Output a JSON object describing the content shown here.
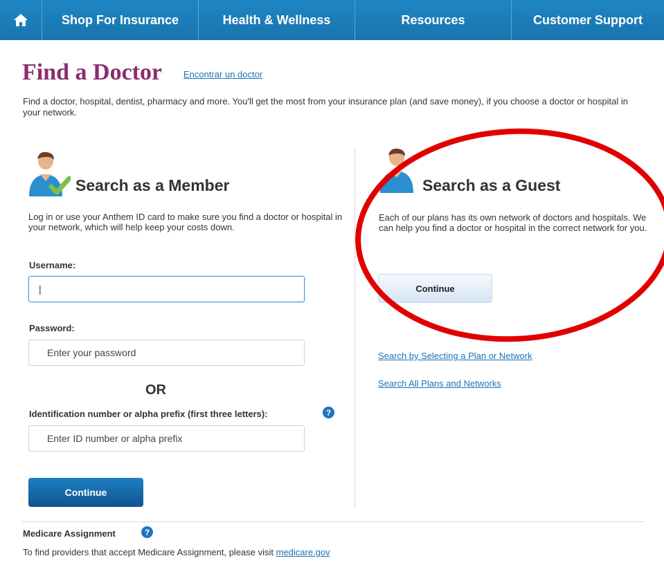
{
  "nav": {
    "home_icon": "home-icon",
    "items": [
      {
        "label": "Shop For Insurance"
      },
      {
        "label": "Health & Wellness"
      },
      {
        "label": "Resources"
      },
      {
        "label": "Customer Support"
      }
    ]
  },
  "header": {
    "title": "Find a Doctor",
    "alt_link": "Encontrar un doctor",
    "intro": "Find a doctor, hospital, dentist, pharmacy and more. You'll get the most from your insurance plan (and save money), if you choose a doctor or hospital in your network."
  },
  "member": {
    "avatar_icon": "member-avatar-check-icon",
    "title": "Search as a Member",
    "description": "Log in or use your Anthem ID card to make sure you find a doctor or hospital in your network, which will help keep your costs down.",
    "username_label": "Username:",
    "username_value": "|",
    "password_label": "Password:",
    "password_placeholder": "Enter your password",
    "or_text": "OR",
    "id_label": "Identification number or alpha prefix (first three letters):",
    "id_placeholder": "Enter ID number or alpha prefix",
    "continue_label": "Continue"
  },
  "guest": {
    "avatar_icon": "guest-avatar-icon",
    "title": "Search as a Guest",
    "description": "Each of our plans has its own network of doctors and hospitals. We can help you find a doctor or hospital in the correct network for you.",
    "continue_label": "Continue",
    "link_plan": "Search by Selecting a Plan or Network",
    "link_all": "Search All Plans and Networks"
  },
  "footer": {
    "medicare_title": "Medicare Assignment",
    "medicare_text": "To find providers that accept Medicare Assignment, please visit ",
    "medicare_link": "medicare.gov"
  },
  "colors": {
    "nav_blue": "#1b7bb8",
    "title_purple": "#8b2d6e",
    "link_blue": "#1a73b6",
    "annotation_red": "#e00000"
  }
}
